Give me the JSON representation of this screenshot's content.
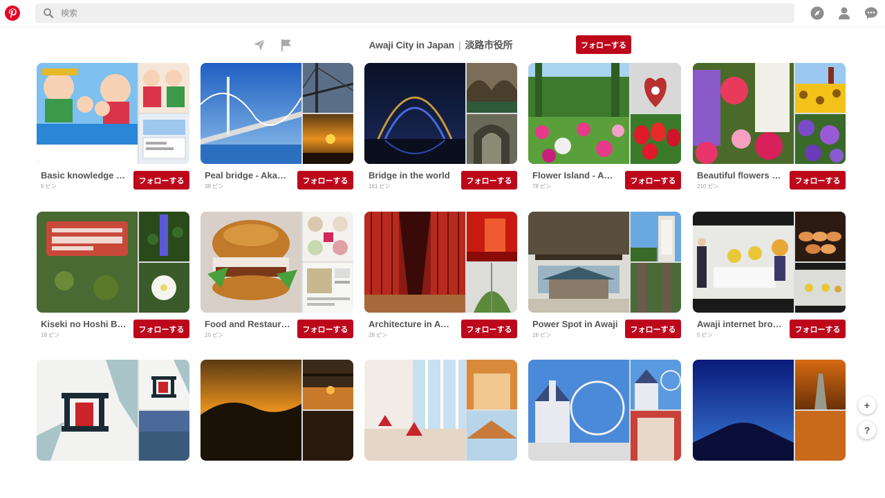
{
  "search": {
    "placeholder": "検索"
  },
  "header_icons": [
    "pinterest-logo-icon",
    "search-icon",
    "explore-compass-icon",
    "profile-icon",
    "messages-icon"
  ],
  "profile": {
    "name_en": "Awaji City in Japan",
    "separator": "|",
    "name_ja": "淡路市役所",
    "follow_label": "フォローする",
    "action_icons": [
      "send-icon",
      "flag-icon"
    ]
  },
  "colors": {
    "brand": "#bd081c",
    "logo": "#e60023",
    "text": "#555555"
  },
  "boards": [
    {
      "title": "Basic knowledge of Awaji",
      "pins": "5 ピン",
      "follow": "フォローする"
    },
    {
      "title": "Peal bridge - Akashi Kaikyo",
      "pins": "38 ピン",
      "follow": "フォローする"
    },
    {
      "title": "Bridge in the world",
      "pins": "161 ピン",
      "follow": "フォローする"
    },
    {
      "title": "Flower Island - Awaji",
      "pins": "78 ピン",
      "follow": "フォローする"
    },
    {
      "title": "Beautiful flowers of Awaji",
      "pins": "210 ピン",
      "follow": "フォローする"
    },
    {
      "title": "Kiseki no Hoshi Botanical",
      "pins": "19 ピン",
      "follow": "フォローする"
    },
    {
      "title": "Food and Restaurants",
      "pins": "10 ピン",
      "follow": "フォローする"
    },
    {
      "title": "Architecture in Awaji",
      "pins": "28 ピン",
      "follow": "フォローする"
    },
    {
      "title": "Power Spot in Awaji",
      "pins": "16 ピン",
      "follow": "フォローする"
    },
    {
      "title": "Awaji internet broadcast",
      "pins": "5 ピン",
      "follow": "フォローする"
    },
    {
      "title": "",
      "pins": "",
      "follow": ""
    },
    {
      "title": "",
      "pins": "",
      "follow": ""
    },
    {
      "title": "",
      "pins": "",
      "follow": ""
    },
    {
      "title": "",
      "pins": "",
      "follow": ""
    },
    {
      "title": "",
      "pins": "",
      "follow": ""
    }
  ],
  "floating": {
    "add": "+",
    "help": "?"
  }
}
